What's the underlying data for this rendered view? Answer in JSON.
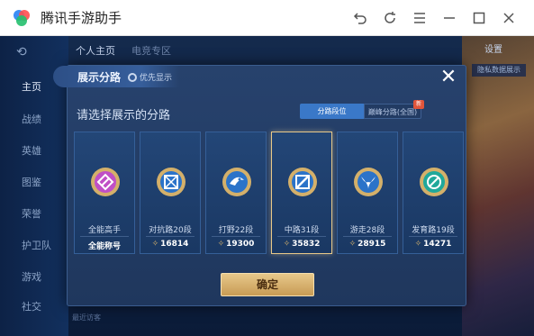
{
  "window": {
    "title": "腾讯手游助手",
    "controls": [
      "undo-icon",
      "refresh-icon",
      "menu-icon",
      "minimize-icon",
      "maximize-icon",
      "close-icon"
    ]
  },
  "background": {
    "top_tabs": [
      "个人主页",
      "电竞专区"
    ],
    "nav_items": [
      "主页",
      "战绩",
      "英雄",
      "图鉴",
      "荣誉",
      "护卫队",
      "游戏",
      "社交"
    ],
    "settings_label": "设置",
    "right_tag": "隐私数据展示",
    "bottom_hint": "最近访客"
  },
  "modal": {
    "title": "展示分路",
    "priority_label": "优先显示",
    "subtitle": "请选择展示的分路",
    "segments": [
      "分路段位",
      "巅峰分路(全国)"
    ],
    "new_badge": "新",
    "confirm_label": "确定",
    "cards": [
      {
        "name": "全能高手",
        "score": "全能称号",
        "show_chevron": false,
        "color": "#c04fc6"
      },
      {
        "name": "对抗路20段",
        "score": "16814",
        "show_chevron": true,
        "color": "#2b73c9"
      },
      {
        "name": "打野22段",
        "score": "19300",
        "show_chevron": true,
        "color": "#2b73c9"
      },
      {
        "name": "中路31段",
        "score": "35832",
        "show_chevron": true,
        "color": "#2b73c9",
        "selected": true
      },
      {
        "name": "游走28段",
        "score": "28915",
        "show_chevron": true,
        "color": "#2b73c9"
      },
      {
        "name": "发育路19段",
        "score": "14271",
        "show_chevron": true,
        "color": "#1fa89b"
      }
    ]
  }
}
